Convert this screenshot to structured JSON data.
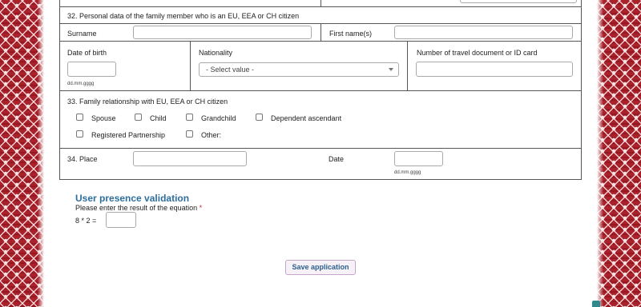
{
  "section_32": {
    "title": "32. Personal data of the family member who is an EU, EEA or CH citizen",
    "surname_label": "Surname",
    "first_names_label": "First name(s)",
    "date_of_birth_label": "Date of birth",
    "date_format_hint": "dd.mm.gggg",
    "nationality_label": "Nationality",
    "nationality_selected": "- Select value -",
    "travel_document_label": "Number of travel document or ID card"
  },
  "section_33": {
    "title": "33. Family relationship with EU, EEA or CH citizen",
    "options": [
      "Spouse",
      "Child",
      "Grandchild",
      "Dependent ascendant",
      "Registered Partnership",
      "Other:"
    ]
  },
  "section_34": {
    "place_label": "34. Place",
    "date_label": "Date",
    "date_format_hint": "dd.mm.gggg"
  },
  "validation": {
    "title": "User presence validation",
    "instruction": "Please enter the result of the equation",
    "required_marker": "*",
    "equation": "8 * 2 ="
  },
  "actions": {
    "save_label": "Save application"
  },
  "colors": {
    "border_pattern": "#a8212b",
    "validation_title": "#2e6e9e",
    "required": "#d0282e",
    "save_text": "#2e5f8c"
  }
}
